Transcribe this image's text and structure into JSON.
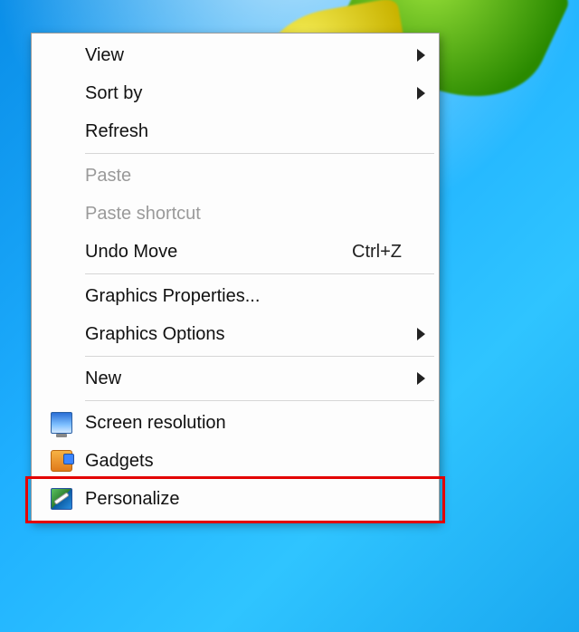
{
  "menu": {
    "items": [
      {
        "id": "view",
        "label": "View",
        "enabled": true,
        "submenu": true,
        "icon": null
      },
      {
        "id": "sort-by",
        "label": "Sort by",
        "enabled": true,
        "submenu": true,
        "icon": null
      },
      {
        "id": "refresh",
        "label": "Refresh",
        "enabled": true,
        "submenu": false,
        "icon": null
      },
      {
        "separator": true
      },
      {
        "id": "paste",
        "label": "Paste",
        "enabled": false,
        "submenu": false,
        "icon": null
      },
      {
        "id": "paste-shortcut",
        "label": "Paste shortcut",
        "enabled": false,
        "submenu": false,
        "icon": null
      },
      {
        "id": "undo-move",
        "label": "Undo Move",
        "enabled": true,
        "submenu": false,
        "icon": null,
        "shortcut": "Ctrl+Z"
      },
      {
        "separator": true
      },
      {
        "id": "graphics-properties",
        "label": "Graphics Properties...",
        "enabled": true,
        "submenu": false,
        "icon": null
      },
      {
        "id": "graphics-options",
        "label": "Graphics Options",
        "enabled": true,
        "submenu": true,
        "icon": null
      },
      {
        "separator": true
      },
      {
        "id": "new",
        "label": "New",
        "enabled": true,
        "submenu": true,
        "icon": null
      },
      {
        "separator": true
      },
      {
        "id": "screen-resolution",
        "label": "Screen resolution",
        "enabled": true,
        "submenu": false,
        "icon": "monitor"
      },
      {
        "id": "gadgets",
        "label": "Gadgets",
        "enabled": true,
        "submenu": false,
        "icon": "gadgets"
      },
      {
        "id": "personalize",
        "label": "Personalize",
        "enabled": true,
        "submenu": false,
        "icon": "personalize"
      }
    ]
  },
  "highlight": {
    "target_id": "personalize",
    "color": "#e30000"
  }
}
